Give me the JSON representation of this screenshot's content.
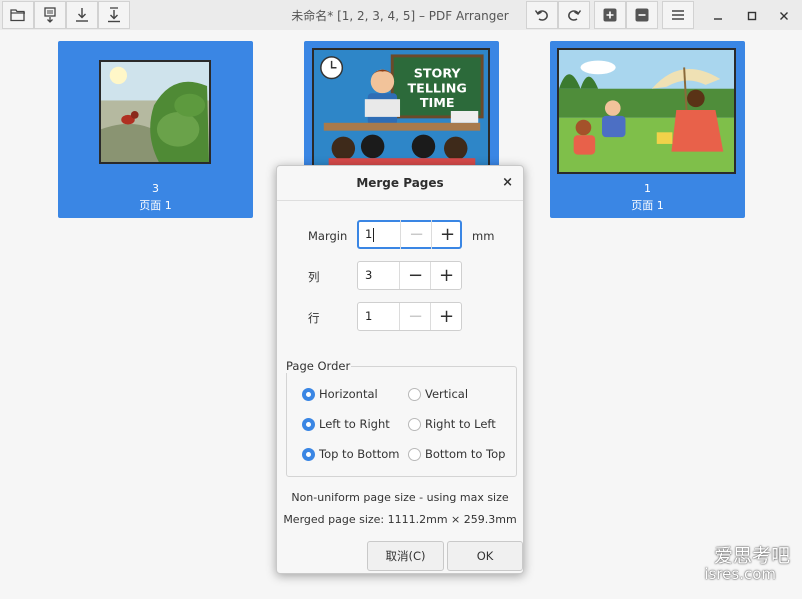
{
  "window": {
    "title": "未命名* [1, 2, 3, 4, 5] – PDF Arranger"
  },
  "toolbar": {
    "buttons": [
      "open-icon",
      "save-icon",
      "export-icon",
      "export-all-icon"
    ],
    "undo_icon": "undo-icon",
    "redo_icon": "redo-icon",
    "zoom_in_icon": "zoom-in-icon",
    "zoom_out_icon": "zoom-out-icon",
    "menu_icon": "menu-icon"
  },
  "pages": [
    {
      "number": "3",
      "label": "页面 1"
    },
    {
      "number": "",
      "label": ""
    },
    {
      "number": "1",
      "label": "页面 1"
    }
  ],
  "dialog": {
    "title": "Merge Pages",
    "close": "×",
    "margin_label": "Margin",
    "margin_value": "1",
    "margin_unit": "mm",
    "cols_label": "列",
    "cols_value": "3",
    "rows_label": "行",
    "rows_value": "1",
    "page_order_title": "Page Order",
    "radios": {
      "horizontal": "Horizontal",
      "vertical": "Vertical",
      "left_to_right": "Left to Right",
      "right_to_left": "Right to Left",
      "top_to_bottom": "Top to Bottom",
      "bottom_to_top": "Bottom to Top"
    },
    "info1": "Non-uniform page size - using max size",
    "info2": "Merged page size: 1111.2mm × 259.3mm",
    "cancel_label": "取消(C)",
    "ok_label": "OK"
  },
  "watermark": {
    "line1": "爱思考吧",
    "line2": "isres.com"
  },
  "colors": {
    "accent": "#3a86e4",
    "header": "#ebebeb"
  }
}
